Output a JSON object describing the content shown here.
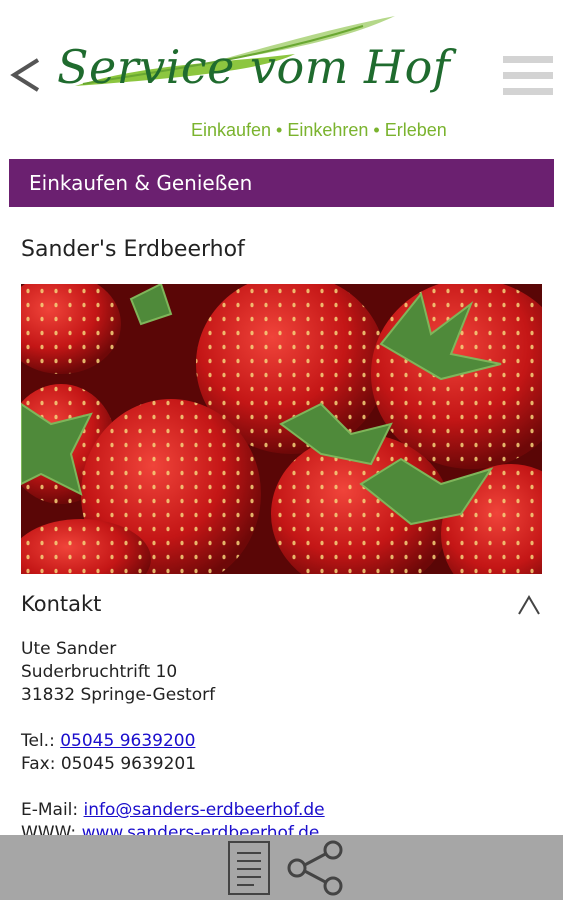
{
  "header": {
    "back_icon": "chevron-left-icon",
    "logo_title": "Service vom Hof",
    "logo_tagline": "Einkaufen • Einkehren • Erleben",
    "menu_icon": "hamburger-menu-icon"
  },
  "section": {
    "title": "Einkaufen & Genießen"
  },
  "farm": {
    "name": "Sander's Erdbeerhof",
    "photo": "strawberries-photo"
  },
  "contact": {
    "heading": "Kontakt",
    "collapse_icon": "chevron-up-icon",
    "name": "Ute Sander",
    "street": "Suderbruchtrift 10",
    "city": "31832 Springe-Gestorf",
    "phone_label": "Tel.:",
    "phone": "05045 9639200",
    "fax_label": "Fax:",
    "fax": "05045 9639201",
    "email_label": "E-Mail:",
    "email": "info@sanders-erdbeerhof.de",
    "www_label": "WWW:",
    "www": "www.sanders-erdbeerhof.de"
  },
  "bottom_bar": {
    "document_icon": "document-icon",
    "share_icon": "share-icon"
  },
  "colors": {
    "section_bar": "#6b2070",
    "logo_green": "#1f6b2e",
    "tagline_green": "#7ab32e",
    "link": "#1a0dcc",
    "bottom_bar": "#a6a6a6"
  }
}
